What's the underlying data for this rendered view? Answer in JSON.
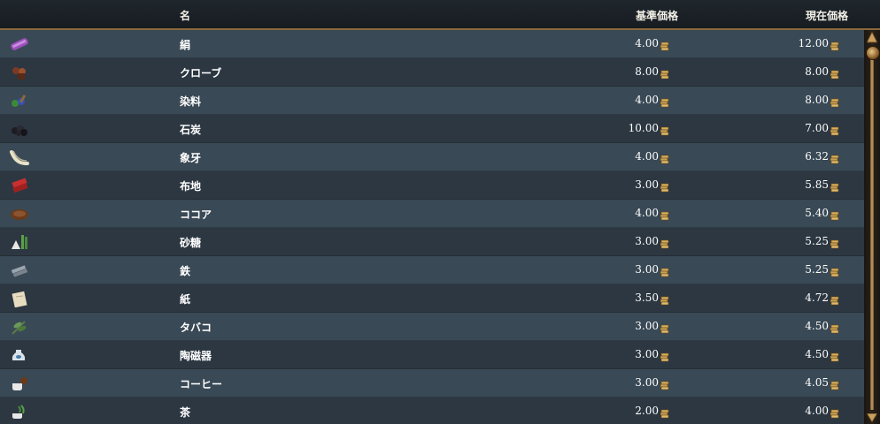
{
  "header": {
    "name_label": "名",
    "base_price_label": "基準価格",
    "current_price_label": "現在価格"
  },
  "colors": {
    "header_bg": "#1b2127",
    "row_light": "#394955",
    "row_dark": "#2c3741",
    "gold": "#c9a060",
    "text": "#ffffff"
  },
  "goods": [
    {
      "icon": "silk-icon",
      "name": "絹",
      "base": "4.00",
      "current": "12.00"
    },
    {
      "icon": "cloves-icon",
      "name": "クローブ",
      "base": "8.00",
      "current": "8.00"
    },
    {
      "icon": "dyes-icon",
      "name": "染料",
      "base": "4.00",
      "current": "8.00"
    },
    {
      "icon": "coal-icon",
      "name": "石炭",
      "base": "10.00",
      "current": "7.00"
    },
    {
      "icon": "ivory-icon",
      "name": "象牙",
      "base": "4.00",
      "current": "6.32"
    },
    {
      "icon": "cloth-icon",
      "name": "布地",
      "base": "3.00",
      "current": "5.85"
    },
    {
      "icon": "cocoa-icon",
      "name": "ココア",
      "base": "4.00",
      "current": "5.40"
    },
    {
      "icon": "sugar-icon",
      "name": "砂糖",
      "base": "3.00",
      "current": "5.25"
    },
    {
      "icon": "iron-icon",
      "name": "鉄",
      "base": "3.00",
      "current": "5.25"
    },
    {
      "icon": "paper-icon",
      "name": "紙",
      "base": "3.50",
      "current": "4.72"
    },
    {
      "icon": "tobacco-icon",
      "name": "タバコ",
      "base": "3.00",
      "current": "4.50"
    },
    {
      "icon": "porcelain-icon",
      "name": "陶磁器",
      "base": "3.00",
      "current": "4.50"
    },
    {
      "icon": "coffee-icon",
      "name": "コーヒー",
      "base": "3.00",
      "current": "4.05"
    },
    {
      "icon": "tea-icon",
      "name": "茶",
      "base": "2.00",
      "current": "4.00"
    }
  ]
}
